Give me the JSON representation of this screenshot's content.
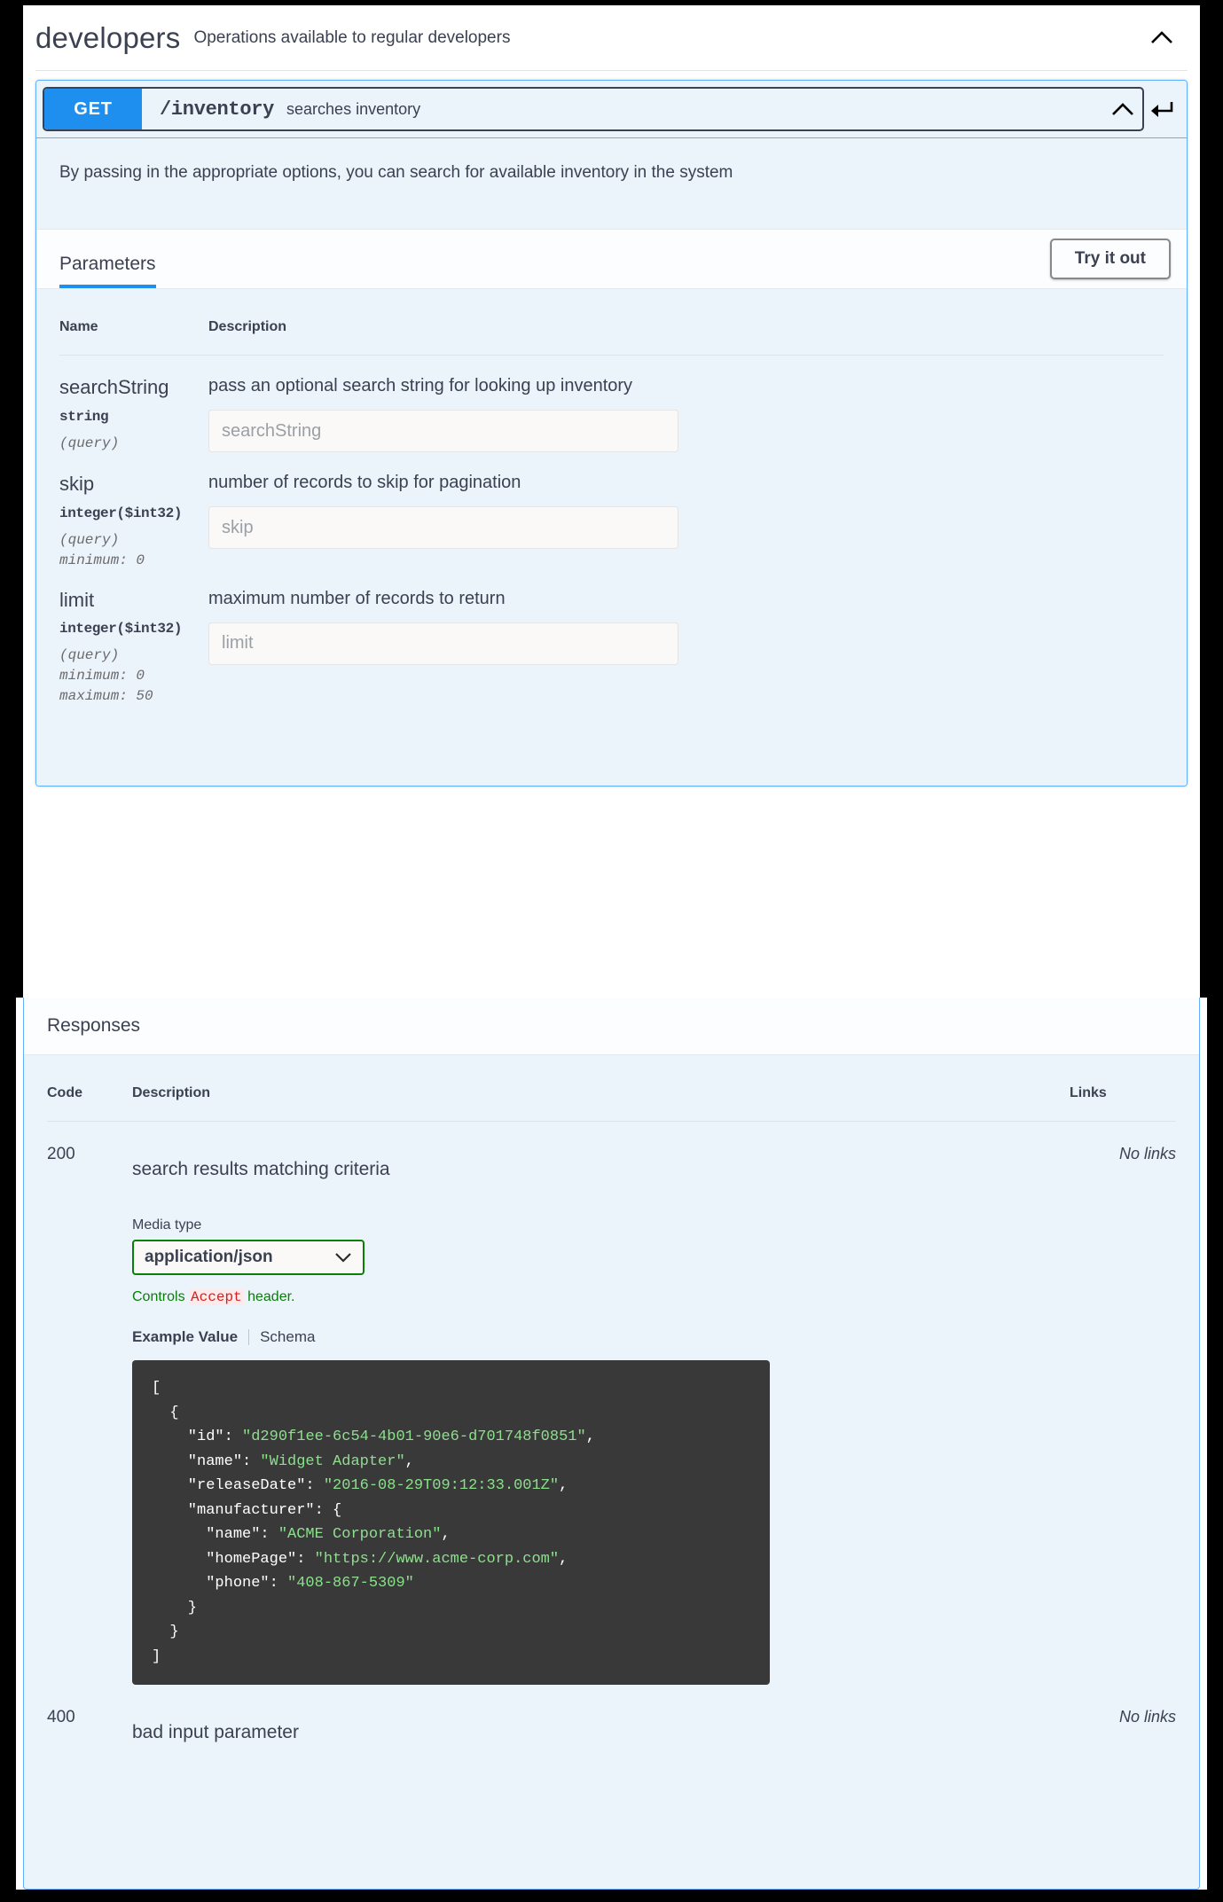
{
  "tag": {
    "name": "developers",
    "description": "Operations available to regular developers",
    "collapse_icon": "chevron-up-icon"
  },
  "operation": {
    "method": "GET",
    "path": "/inventory",
    "summary": "searches inventory",
    "description": "By passing in the appropriate options, you can search for available inventory in the system",
    "collapse_icon": "chevron-up-icon",
    "deeplink_icon": "arrow-return-icon"
  },
  "parameters_section": {
    "tab_label": "Parameters",
    "try_it_out_label": "Try it out",
    "columns": {
      "name": "Name",
      "description": "Description"
    },
    "rows": [
      {
        "name": "searchString",
        "type": "string",
        "in": "(query)",
        "constraints": [],
        "description": "pass an optional search string for looking up inventory",
        "input_placeholder": "searchString",
        "input_value": ""
      },
      {
        "name": "skip",
        "type": "integer($int32)",
        "in": "(query)",
        "constraints": [
          "minimum: 0"
        ],
        "description": "number of records to skip for pagination",
        "input_placeholder": "skip",
        "input_value": ""
      },
      {
        "name": "limit",
        "type": "integer($int32)",
        "in": "(query)",
        "constraints": [
          "minimum: 0",
          "maximum: 50"
        ],
        "description": "maximum number of records to return",
        "input_placeholder": "limit",
        "input_value": ""
      }
    ]
  },
  "responses_section": {
    "title": "Responses",
    "columns": {
      "code": "Code",
      "description": "Description",
      "links": "Links"
    },
    "rows": [
      {
        "code": "200",
        "description": "search results matching criteria",
        "links": "No links",
        "media_type_label": "Media type",
        "media_type_value": "application/json",
        "media_type_caret": "chevron-down-icon",
        "controls_note_prefix": "Controls",
        "controls_note_keyword": "Accept",
        "controls_note_suffix": "header.",
        "example_tab_label": "Example Value",
        "schema_tab_label": "Schema",
        "example_code_lines": [
          [
            {
              "t": "[",
              "c": "p"
            }
          ],
          [
            {
              "t": "  {",
              "c": "p"
            }
          ],
          [
            {
              "t": "    \"id\": ",
              "c": "k"
            },
            {
              "t": "\"d290f1ee-6c54-4b01-90e6-d701748f0851\"",
              "c": "s"
            },
            {
              "t": ",",
              "c": "p"
            }
          ],
          [
            {
              "t": "    \"name\": ",
              "c": "k"
            },
            {
              "t": "\"Widget Adapter\"",
              "c": "s"
            },
            {
              "t": ",",
              "c": "p"
            }
          ],
          [
            {
              "t": "    \"releaseDate\": ",
              "c": "k"
            },
            {
              "t": "\"2016-08-29T09:12:33.001Z\"",
              "c": "s"
            },
            {
              "t": ",",
              "c": "p"
            }
          ],
          [
            {
              "t": "    \"manufacturer\": {",
              "c": "k"
            }
          ],
          [
            {
              "t": "      \"name\": ",
              "c": "k"
            },
            {
              "t": "\"ACME Corporation\"",
              "c": "s"
            },
            {
              "t": ",",
              "c": "p"
            }
          ],
          [
            {
              "t": "      \"homePage\": ",
              "c": "k"
            },
            {
              "t": "\"https://www.acme-corp.com\"",
              "c": "s"
            },
            {
              "t": ",",
              "c": "p"
            }
          ],
          [
            {
              "t": "      \"phone\": ",
              "c": "k"
            },
            {
              "t": "\"408-867-5309\"",
              "c": "s"
            }
          ],
          [
            {
              "t": "    }",
              "c": "p"
            }
          ],
          [
            {
              "t": "  }",
              "c": "p"
            }
          ],
          [
            {
              "t": "]",
              "c": "p"
            }
          ]
        ]
      },
      {
        "code": "400",
        "description": "bad input parameter",
        "links": "No links"
      }
    ]
  },
  "colors": {
    "get_method": "#1f8fef",
    "opblock_border": "#61affe",
    "opblock_bg": "#ebf3fb",
    "text": "#3b4151",
    "code_bg": "#393939",
    "code_string": "#8ce08c",
    "media_border": "#0a7d0a",
    "accept_keyword": "#d41f1f"
  }
}
